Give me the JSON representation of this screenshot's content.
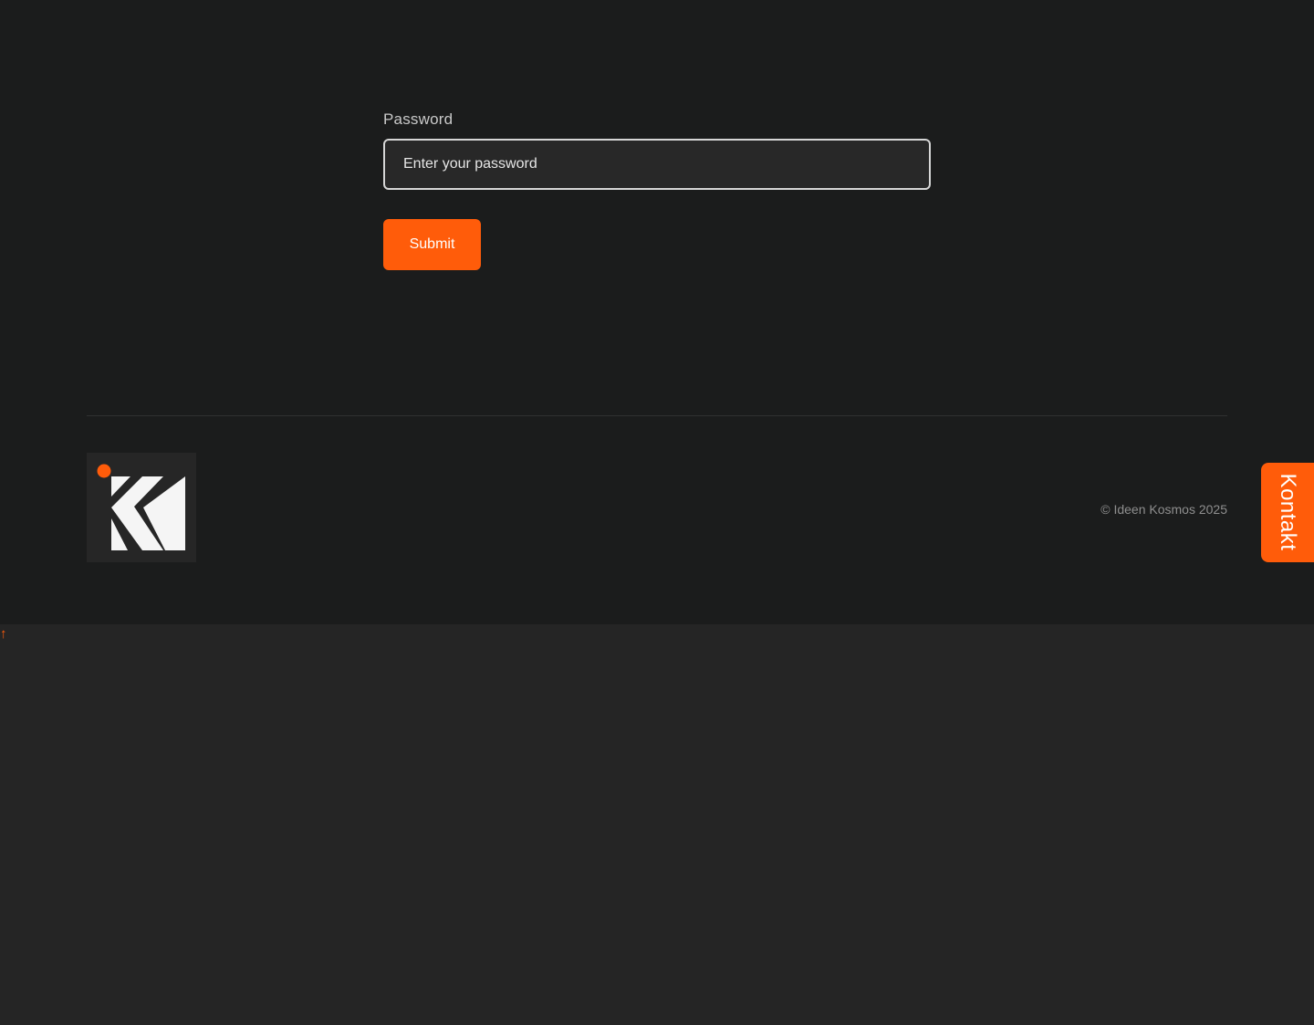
{
  "form": {
    "password_label": "Password",
    "password_placeholder": "Enter your password",
    "password_value": "",
    "submit_label": "Submit"
  },
  "footer": {
    "logo_letter": "K",
    "copyright": "© Ideen Kosmos 2025"
  },
  "kontakt_tab": {
    "label": "Kontakt"
  },
  "scroll_top": {
    "glyph": "↑"
  },
  "colors": {
    "accent": "#ff5c0a",
    "page_background": "#1b1c1c",
    "lower_background": "#252525",
    "input_background": "#282828",
    "input_border": "#d6d6d6",
    "copyright_text": "#8e8e8e"
  },
  "icons": {
    "logo": "k-chevron-logo",
    "scroll_top": "arrow-up-icon"
  }
}
